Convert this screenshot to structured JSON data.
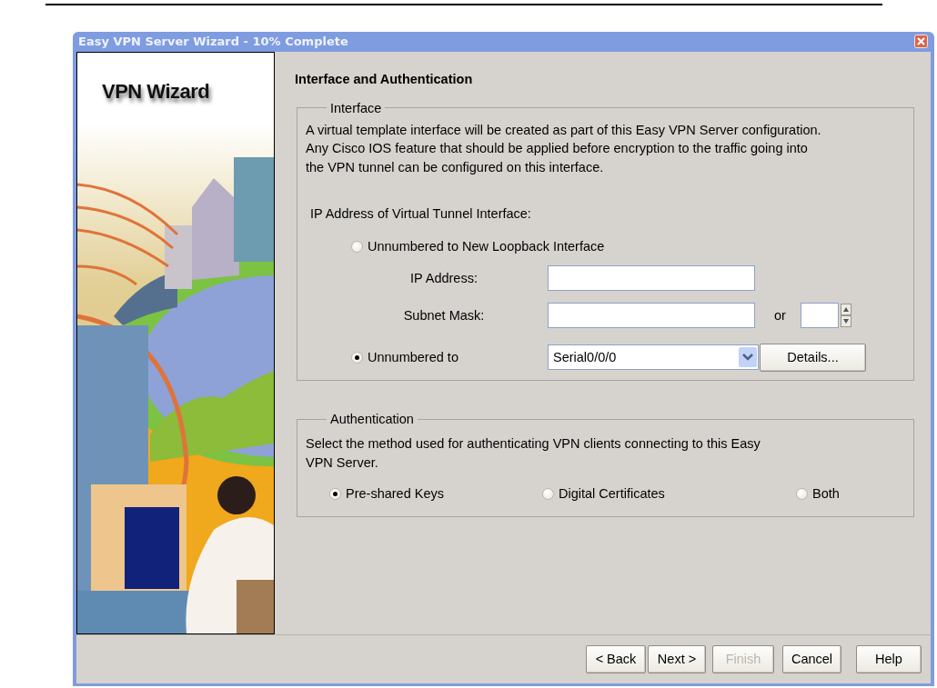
{
  "window": {
    "title": "Easy VPN Server Wizard - 10% Complete"
  },
  "sidebar": {
    "title": "VPN Wizard"
  },
  "page": {
    "heading": "Interface and Authentication"
  },
  "interface": {
    "legend": "Interface",
    "description": "A virtual template interface will be created as part of this Easy VPN Server configuration.\nAny Cisco IOS feature that should be applied before encryption to the traffic going into\nthe VPN tunnel can be configured on this interface.",
    "address_label": "IP Address of Virtual Tunnel Interface:",
    "options": [
      {
        "label": "Unnumbered to New Loopback Interface",
        "selected": false
      },
      {
        "label": "Unnumbered to",
        "selected": true
      }
    ],
    "ip_address": {
      "label": "IP Address:"
    },
    "subnet_mask": {
      "label": "Subnet Mask:",
      "or_label": "or"
    },
    "interface_select": {
      "value": "Serial0/0/0"
    },
    "details_button": "Details..."
  },
  "authentication": {
    "legend": "Authentication",
    "description": "Select the method used for authenticating VPN clients connecting to this Easy\nVPN Server.",
    "options": [
      {
        "label": "Pre-shared Keys",
        "selected": true
      },
      {
        "label": "Digital Certificates",
        "selected": false
      },
      {
        "label": "Both",
        "selected": false
      }
    ]
  },
  "buttons": [
    {
      "label": "< Back",
      "disabled": false
    },
    {
      "label": "Next >",
      "disabled": false
    },
    {
      "label": "Finish",
      "disabled": true
    },
    {
      "label": "Cancel",
      "disabled": false
    },
    {
      "label": "Help",
      "disabled": false
    }
  ]
}
